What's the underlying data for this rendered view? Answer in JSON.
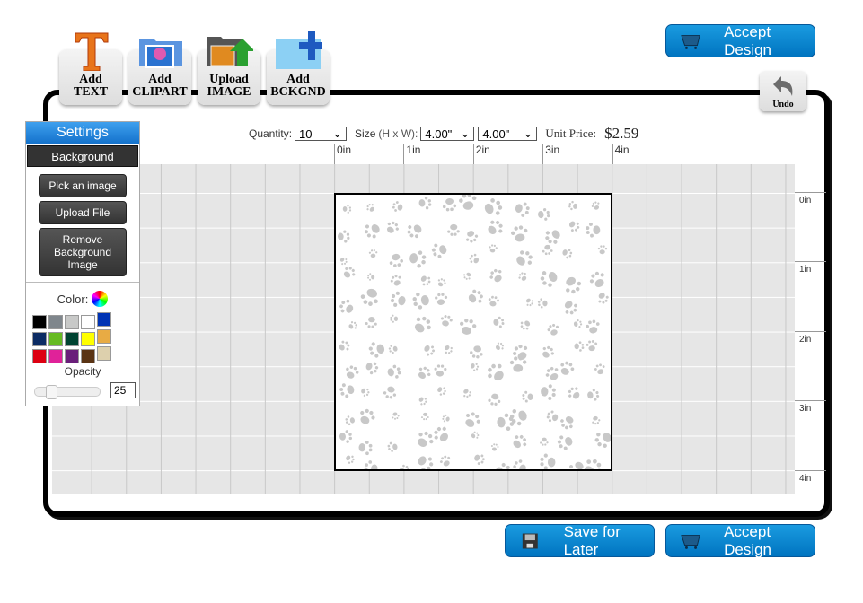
{
  "toolbar": {
    "tools": [
      {
        "line1": "Add",
        "line2": "TEXT",
        "icon": "text-t-icon"
      },
      {
        "line1": "Add",
        "line2": "CLIPART",
        "icon": "clipart-folder-icon"
      },
      {
        "line1": "Upload",
        "line2": "IMAGE",
        "icon": "upload-image-icon"
      },
      {
        "line1": "Add",
        "line2": "BCKGND",
        "icon": "add-background-icon"
      }
    ],
    "undo": "Undo"
  },
  "actions": {
    "accept_top": "Accept Design",
    "save": "Save for Later",
    "accept_bottom": "Accept Design"
  },
  "options": {
    "quantity_label": "Quantity:",
    "quantity": "10",
    "size_label": "Size",
    "size_hint": "(H x W):",
    "height": "4.00\"",
    "width": "4.00\"",
    "price_label": "Unit Price:",
    "price": "$2.59"
  },
  "rulers": {
    "top": [
      "0in",
      "1in",
      "2in",
      "3in",
      "4in"
    ],
    "right": [
      "0in",
      "1in",
      "2in",
      "3in",
      "4in"
    ]
  },
  "settings": {
    "title": "Settings",
    "section": "Background",
    "pick": "Pick an image",
    "upload": "Upload File",
    "remove": "Remove Background Image",
    "color_label": "Color:",
    "opacity_label": "Opacity",
    "opacity": "25",
    "colors": [
      "#000000",
      "#7f868c",
      "#c8c9c8",
      "#ffffff",
      "#0033b4",
      "#0c2c64",
      "#66bb22",
      "#004432",
      "#ffff00",
      "#e8ab44",
      "#dd0011",
      "#e02299",
      "#6a1f7a",
      "#5a3414",
      "#ddd0ad"
    ]
  },
  "colors": {
    "accent": "#0a86d0",
    "paw": "#c8c8c8"
  }
}
